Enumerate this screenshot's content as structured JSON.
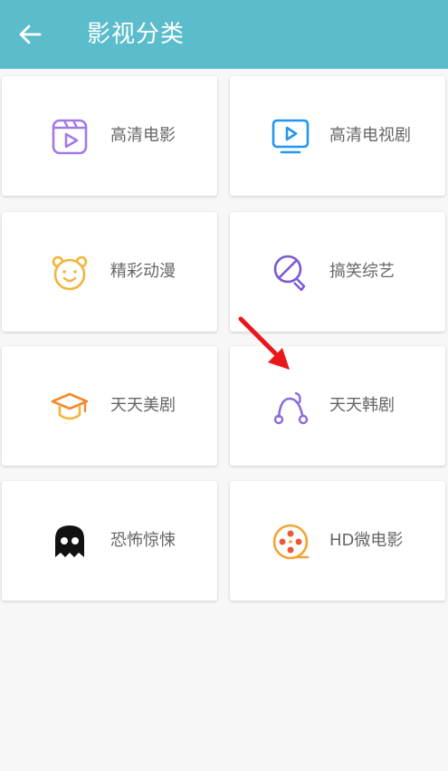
{
  "header": {
    "title": "影视分类",
    "back_icon": "arrow-left-icon",
    "bg_color": "#5bbccb"
  },
  "categories": [
    {
      "label": "高清电影",
      "icon": "film-play-icon",
      "color": "#a27ae6"
    },
    {
      "label": "高清电视剧",
      "icon": "tv-play-icon",
      "color": "#2196f3"
    },
    {
      "label": "精彩动漫",
      "icon": "bear-face-icon",
      "color": "#f2b53a"
    },
    {
      "label": "搞笑综艺",
      "icon": "microphone-icon",
      "color": "#7b57d6"
    },
    {
      "label": "天天美剧",
      "icon": "graduation-cap-icon",
      "color": "#f08a2c"
    },
    {
      "label": "天天韩剧",
      "icon": "music-node-icon",
      "color": "#8a6bd9"
    },
    {
      "label": "恐怖惊悚",
      "icon": "ghost-icon",
      "color": "#111111"
    },
    {
      "label": "HD微电影",
      "icon": "film-reel-icon",
      "color": "#f2a531"
    }
  ],
  "annotation": {
    "icon": "red-arrow-icon",
    "color": "#e8171a"
  }
}
